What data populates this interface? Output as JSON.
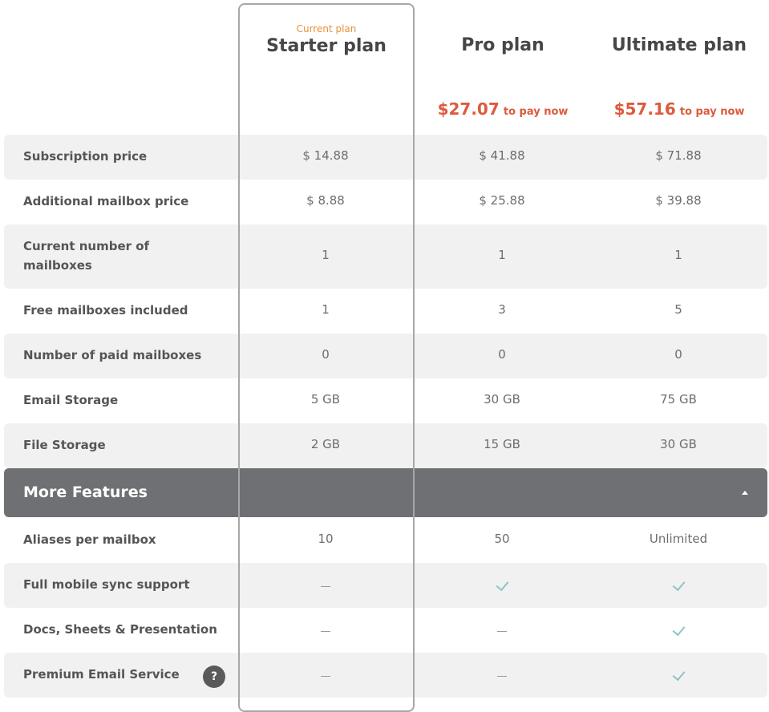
{
  "plans": [
    {
      "current_tag": "Current plan",
      "name": "Starter plan"
    },
    {
      "name": "Pro plan",
      "pay_amount": "$27.07",
      "pay_label": "to pay now"
    },
    {
      "name": "Ultimate plan",
      "pay_amount": "$57.16",
      "pay_label": "to pay now"
    }
  ],
  "rows": [
    {
      "label": "Subscription price",
      "values": [
        "$ 14.88",
        "$ 41.88",
        "$ 71.88"
      ]
    },
    {
      "label": "Additional mailbox price",
      "values": [
        "$ 8.88",
        "$ 25.88",
        "$ 39.88"
      ]
    },
    {
      "label_line1": "Current number of",
      "label_line2": "mailboxes",
      "values": [
        "1",
        "1",
        "1"
      ]
    },
    {
      "label": "Free mailboxes included",
      "values": [
        "1",
        "3",
        "5"
      ]
    },
    {
      "label": "Number of paid mailboxes",
      "values": [
        "0",
        "0",
        "0"
      ]
    },
    {
      "label": "Email Storage",
      "values": [
        "5 GB",
        "30 GB",
        "75 GB"
      ]
    },
    {
      "label": "File Storage",
      "values": [
        "2 GB",
        "15 GB",
        "30 GB"
      ]
    }
  ],
  "more_features": {
    "title": "More Features",
    "rows": [
      {
        "label": "Aliases per mailbox",
        "values": [
          "10",
          "50",
          "Unlimited"
        ]
      },
      {
        "label": "Full mobile sync support",
        "values": [
          "dash",
          "check",
          "check"
        ]
      },
      {
        "label": "Docs, Sheets & Presentation",
        "values": [
          "dash",
          "dash",
          "check"
        ]
      },
      {
        "label": "Premium Email Service",
        "help": "?",
        "values": [
          "dash",
          "dash",
          "check"
        ]
      }
    ]
  }
}
